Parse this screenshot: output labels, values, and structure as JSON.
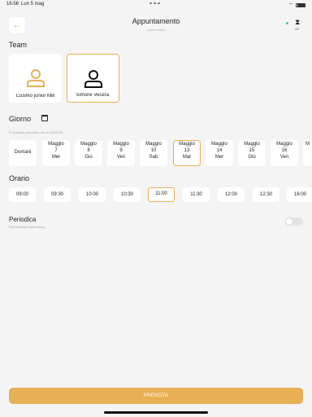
{
  "status_bar": {
    "time": "16:56",
    "date": "Lun 5 mag",
    "battery": ""
  },
  "header": {
    "title": "Appuntamento",
    "subtitle": "nuovo ordine",
    "counter": "29'"
  },
  "team": {
    "label": "Team",
    "members": [
      {
        "name": "Cosimo junior Mik",
        "selected": false
      },
      {
        "name": "Simone Vecera.",
        "selected": true
      }
    ]
  },
  "giorno": {
    "label": "Giorno",
    "note": "È possibile prenotare fino al 5/8/2025",
    "days": [
      {
        "l1": "Domani",
        "l2": "",
        "l3": "",
        "selected": false
      },
      {
        "l1": "Maggio",
        "l2": "7",
        "l3": "Mer",
        "selected": false
      },
      {
        "l1": "Maggio",
        "l2": "8",
        "l3": "Gio",
        "selected": false
      },
      {
        "l1": "Maggio",
        "l2": "9",
        "l3": "Ven",
        "selected": false
      },
      {
        "l1": "Maggio",
        "l2": "10",
        "l3": "Sab",
        "selected": false
      },
      {
        "l1": "Maggio",
        "l2": "13",
        "l3": "Mar",
        "selected": true
      },
      {
        "l1": "Maggio",
        "l2": "14",
        "l3": "Mer",
        "selected": false
      },
      {
        "l1": "Maggio",
        "l2": "15",
        "l3": "Gio",
        "selected": false
      },
      {
        "l1": "Maggio",
        "l2": "16",
        "l3": "Ven",
        "selected": false
      },
      {
        "l1": "M",
        "l2": "",
        "l3": "",
        "selected": false
      }
    ]
  },
  "orario": {
    "label": "Orario",
    "times": [
      {
        "t": "09:00",
        "selected": false
      },
      {
        "t": "09:30",
        "selected": false
      },
      {
        "t": "10:00",
        "selected": false
      },
      {
        "t": "10:30",
        "selected": false
      },
      {
        "t": "11:00",
        "selected": true
      },
      {
        "t": "11:30",
        "selected": false
      },
      {
        "t": "12:00",
        "selected": false
      },
      {
        "t": "12:30",
        "selected": false
      },
      {
        "t": "16:00",
        "selected": false
      }
    ]
  },
  "periodica": {
    "label": "Periodica",
    "sub": "Prenotazione automatica",
    "enabled": false
  },
  "prenota_label": "PRENOTA",
  "colors": {
    "accent": "#e8b055",
    "background": "#f4f4f4",
    "status_dot": "#4cc69a"
  }
}
